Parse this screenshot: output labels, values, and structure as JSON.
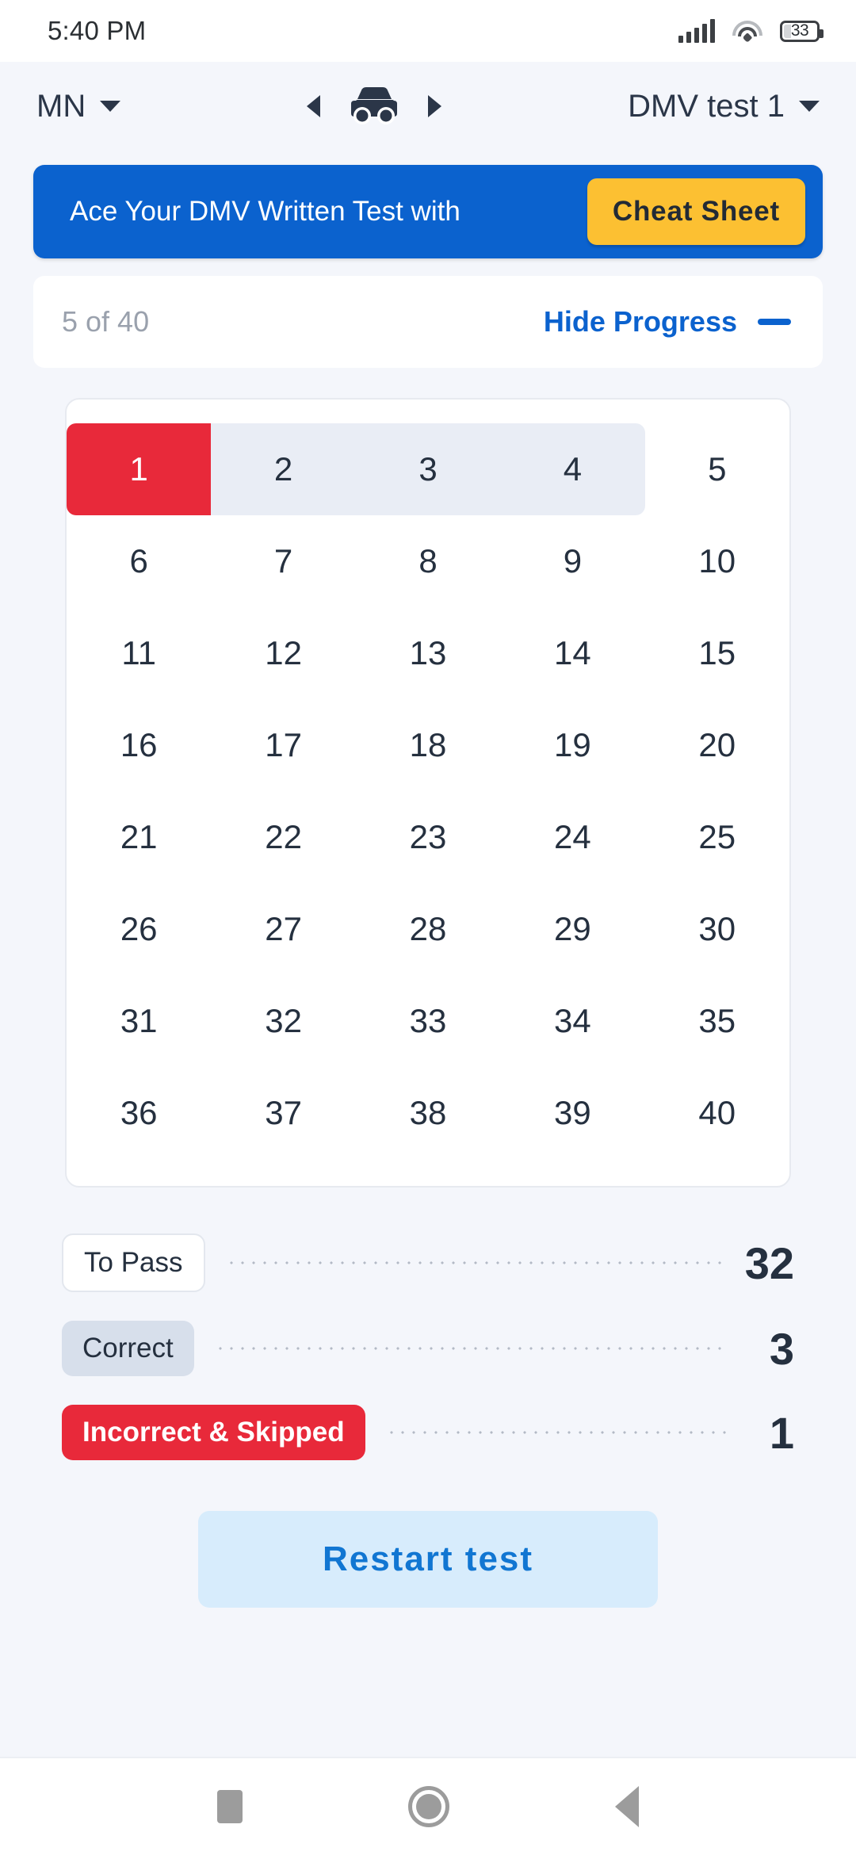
{
  "status_bar": {
    "time": "5:40 PM",
    "battery_percent": "33",
    "signal_icon": "signal-bars-icon",
    "wifi_icon": "wifi-icon",
    "battery_icon": "battery-icon"
  },
  "header": {
    "state": "MN",
    "state_caret_icon": "chevron-down-icon",
    "vehicle_icon": "car-icon",
    "prev_icon": "chevron-left-icon",
    "next_icon": "chevron-right-icon",
    "test_name": "DMV test 1",
    "test_caret_icon": "chevron-down-icon"
  },
  "banner": {
    "text": "Ace Your DMV Written Test with",
    "button_label": "Cheat Sheet",
    "background_color": "#0b62ce",
    "button_color": "#fcc032"
  },
  "progress": {
    "count_label": "5 of 40",
    "toggle_label": "Hide Progress",
    "toggle_icon": "minus-icon",
    "current": 5,
    "total": 40
  },
  "question_grid": {
    "rows": [
      [
        {
          "n": "1",
          "state": "incorrect"
        },
        {
          "n": "2",
          "state": "answered"
        },
        {
          "n": "3",
          "state": "answered"
        },
        {
          "n": "4",
          "state": "answered-last"
        },
        {
          "n": "5",
          "state": "default"
        }
      ],
      [
        {
          "n": "6",
          "state": "default"
        },
        {
          "n": "7",
          "state": "default"
        },
        {
          "n": "8",
          "state": "default"
        },
        {
          "n": "9",
          "state": "default"
        },
        {
          "n": "10",
          "state": "default"
        }
      ],
      [
        {
          "n": "11",
          "state": "default"
        },
        {
          "n": "12",
          "state": "default"
        },
        {
          "n": "13",
          "state": "default"
        },
        {
          "n": "14",
          "state": "default"
        },
        {
          "n": "15",
          "state": "default"
        }
      ],
      [
        {
          "n": "16",
          "state": "default"
        },
        {
          "n": "17",
          "state": "default"
        },
        {
          "n": "18",
          "state": "default"
        },
        {
          "n": "19",
          "state": "default"
        },
        {
          "n": "20",
          "state": "default"
        }
      ],
      [
        {
          "n": "21",
          "state": "default"
        },
        {
          "n": "22",
          "state": "default"
        },
        {
          "n": "23",
          "state": "default"
        },
        {
          "n": "24",
          "state": "default"
        },
        {
          "n": "25",
          "state": "default"
        }
      ],
      [
        {
          "n": "26",
          "state": "default"
        },
        {
          "n": "27",
          "state": "default"
        },
        {
          "n": "28",
          "state": "default"
        },
        {
          "n": "29",
          "state": "default"
        },
        {
          "n": "30",
          "state": "default"
        }
      ],
      [
        {
          "n": "31",
          "state": "default"
        },
        {
          "n": "32",
          "state": "default"
        },
        {
          "n": "33",
          "state": "default"
        },
        {
          "n": "34",
          "state": "default"
        },
        {
          "n": "35",
          "state": "default"
        }
      ],
      [
        {
          "n": "36",
          "state": "default"
        },
        {
          "n": "37",
          "state": "default"
        },
        {
          "n": "38",
          "state": "default"
        },
        {
          "n": "39",
          "state": "default"
        },
        {
          "n": "40",
          "state": "default"
        }
      ]
    ]
  },
  "stats": [
    {
      "label": "To Pass",
      "value": "32",
      "style": "pass"
    },
    {
      "label": "Correct",
      "value": "3",
      "style": "correct"
    },
    {
      "label": "Incorrect & Skipped",
      "value": "1",
      "style": "incorrect"
    }
  ],
  "restart": {
    "label": "Restart test"
  },
  "nav_bar": {
    "recents_icon": "square-recents-icon",
    "home_icon": "circle-home-icon",
    "back_icon": "triangle-back-icon"
  }
}
